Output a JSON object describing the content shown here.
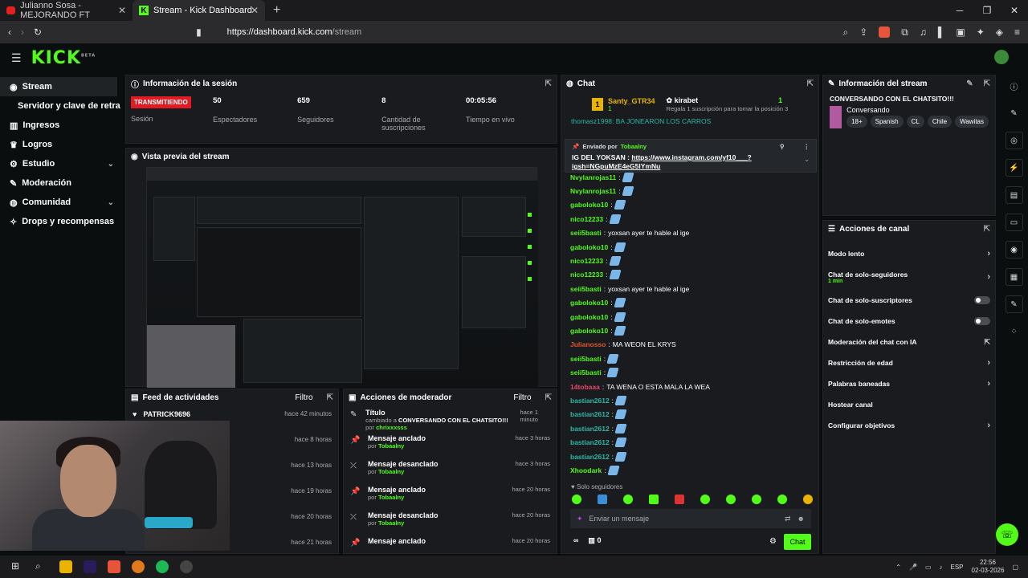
{
  "browser": {
    "tabs": [
      {
        "label": "Julianno Sosa - MEJORANDO FT"
      },
      {
        "label": "Stream - Kick Dashboard"
      }
    ],
    "url_host": "https://dashboard.kick.com",
    "url_path": "/stream",
    "badge_count": "1"
  },
  "sidebar": {
    "items": [
      {
        "label": "Stream"
      },
      {
        "label": "Ingresos"
      },
      {
        "label": "Logros"
      },
      {
        "label": "Estudio"
      },
      {
        "label": "Moderación"
      },
      {
        "label": "Comunidad"
      },
      {
        "label": "Drops y recompensas"
      }
    ],
    "sub_label": "Servidor y clave de retransmisión"
  },
  "session": {
    "title": "Información de la sesión",
    "live_badge": "TRANSMITIENDO",
    "session_label": "Sesión",
    "stats": [
      {
        "value": "50",
        "label": "Espectadores"
      },
      {
        "value": "659",
        "label": "Seguidores"
      },
      {
        "value": "8",
        "label": "Cantidad de suscripciones"
      },
      {
        "value": "00:05:56",
        "label": "Tiempo en vivo"
      }
    ]
  },
  "preview": {
    "title": "Vista previa del stream"
  },
  "feed": {
    "title": "Feed de actividades",
    "filter": "Filtro",
    "rows": [
      {
        "name": "PATRICK9696",
        "time": "hace 42 minutos"
      },
      {
        "name": "",
        "time": "hace 8 horas"
      },
      {
        "name": "",
        "time": "hace 13 horas"
      },
      {
        "name": "",
        "time": "hace 19 horas"
      },
      {
        "name": "",
        "time": "hace 20 horas"
      },
      {
        "name": "",
        "time": "hace 21 horas"
      }
    ]
  },
  "modactions": {
    "title": "Acciones de moderador",
    "filter": "Filtro",
    "rows": [
      {
        "title": "Título",
        "desc": "cambiado a",
        "value": "CONVERSANDO CON EL CHATSITO!!!",
        "by": "por",
        "user": "chrixxxsss",
        "time": "hace 1 minuto"
      },
      {
        "title": "Mensaje anclado",
        "by": "por",
        "user": "Tobaalny",
        "time": "hace 3 horas"
      },
      {
        "title": "Mensaje desanclado",
        "by": "por",
        "user": "Tobaalny",
        "time": "hace 3 horas"
      },
      {
        "title": "Mensaje anclado",
        "by": "por",
        "user": "Tobaalny",
        "time": "hace 20 horas"
      },
      {
        "title": "Mensaje desanclado",
        "by": "por",
        "user": "Tobaalny",
        "time": "hace 20 horas"
      },
      {
        "title": "Mensaje anclado",
        "by": "",
        "user": "",
        "time": "hace 20 horas"
      }
    ]
  },
  "chat": {
    "title": "Chat",
    "top_gifter": {
      "rank": "1",
      "name": "Santy_GTR34",
      "count": "1",
      "gifter": "kirabet",
      "gift_count": "1",
      "gift_text": "Regala 1 suscripción para tomar la posición 3"
    },
    "cut_msg": "thomasz1998: BA JONEARON LOS CARROS",
    "pinned": {
      "label": "Enviado por",
      "user": "Tobaalny",
      "text": "IG DEL YOKSAN :",
      "link": "https://www.instagram.com/yf10___?igsh=NGpuMzE4eG5lYmNu"
    },
    "messages": [
      {
        "user": "Nvylanrojas11",
        "color": "#53fc18",
        "text": ""
      },
      {
        "user": "Nvylanrojas11",
        "color": "#53fc18",
        "text": ""
      },
      {
        "user": "gaboloko10",
        "color": "#53fc18",
        "text": ""
      },
      {
        "user": "nico12233",
        "color": "#53fc18",
        "text": ""
      },
      {
        "user": "seii5basti",
        "color": "#53fc18",
        "text": "yoxsan ayer te hable al ige"
      },
      {
        "user": "gaboloko10",
        "color": "#53fc18",
        "text": ""
      },
      {
        "user": "nico12233",
        "color": "#53fc18",
        "text": ""
      },
      {
        "user": "nico12233",
        "color": "#53fc18",
        "text": ""
      },
      {
        "user": "seii5basti",
        "color": "#53fc18",
        "text": "yoxsan ayer te hable al ige"
      },
      {
        "user": "gaboloko10",
        "color": "#53fc18",
        "text": ""
      },
      {
        "user": "gaboloko10",
        "color": "#53fc18",
        "text": ""
      },
      {
        "user": "gaboloko10",
        "color": "#53fc18",
        "text": ""
      },
      {
        "user": "Julianosso",
        "color": "#e0562b",
        "text": "MA WEON EL KRYS"
      },
      {
        "user": "seii5basti",
        "color": "#53fc18",
        "text": ""
      },
      {
        "user": "seii5basti",
        "color": "#53fc18",
        "text": ""
      },
      {
        "user": "14tobaaa",
        "color": "#e8456b",
        "text": "TA WENA O ESTA MALA LA WEA"
      },
      {
        "user": "bastian2612",
        "color": "#2fb6a6",
        "text": ""
      },
      {
        "user": "bastian2612",
        "color": "#2fb6a6",
        "text": ""
      },
      {
        "user": "bastian2612",
        "color": "#2fb6a6",
        "text": ""
      },
      {
        "user": "bastian2612",
        "color": "#2fb6a6",
        "text": ""
      },
      {
        "user": "bastian2612",
        "color": "#2fb6a6",
        "text": ""
      },
      {
        "user": "Xhoodark",
        "color": "#53fc18",
        "text": ""
      }
    ],
    "mode": "Solo seguidores",
    "placeholder": "Enviar un mensaje",
    "points": "0",
    "send": "Chat"
  },
  "streaminfo": {
    "title": "Información del stream",
    "stream_title": "CONVERSANDO CON EL CHATSITO!!!",
    "category": "Conversando",
    "tags": [
      "18+",
      "Spanish",
      "CL",
      "Chile",
      "Wawitas"
    ]
  },
  "channel": {
    "title": "Acciones de canal",
    "items": [
      {
        "label": "Modo lento",
        "kind": "arrow"
      },
      {
        "label": "Chat de solo-seguidores",
        "sub": "1 min",
        "kind": "arrow"
      },
      {
        "label": "Chat de solo-suscriptores",
        "kind": "toggle"
      },
      {
        "label": "Chat de solo-emotes",
        "kind": "toggle"
      },
      {
        "label": "Moderación del chat con IA",
        "kind": "ext"
      },
      {
        "label": "Restricción de edad",
        "kind": "arrow"
      },
      {
        "label": "Palabras baneadas",
        "kind": "arrow"
      },
      {
        "label": "Hostear canal",
        "kind": "none"
      },
      {
        "label": "Configurar objetivos",
        "kind": "arrow"
      }
    ]
  },
  "taskbar": {
    "lang": "ESP",
    "time": "22:56",
    "date": "02-03-2026"
  },
  "colors": {
    "accent": "#53fc18",
    "live": "#e01b24"
  }
}
